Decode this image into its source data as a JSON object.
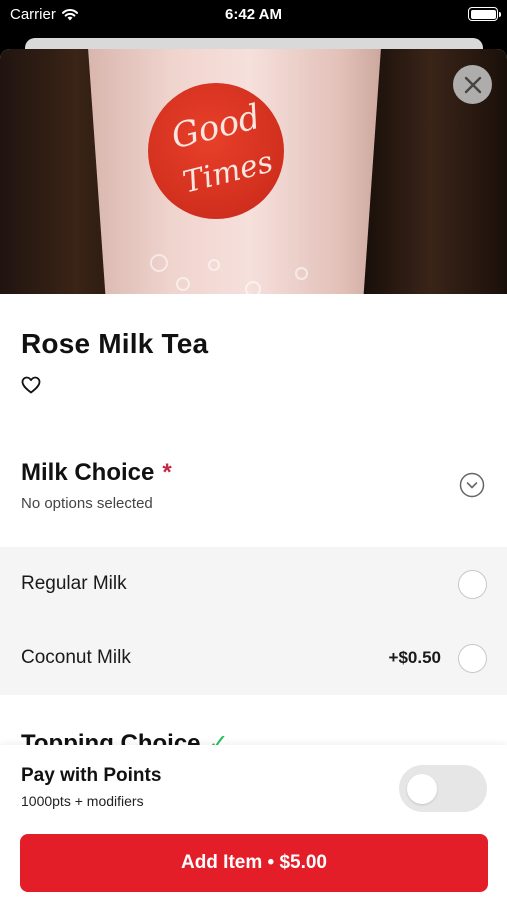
{
  "status_bar": {
    "carrier": "Carrier",
    "time": "6:42 AM"
  },
  "hero": {
    "stamp_line1": "Good",
    "stamp_line2": "Times"
  },
  "item": {
    "title": "Rose Milk Tea"
  },
  "milk_choice": {
    "title": "Milk Choice",
    "required_mark": "*",
    "subtitle": "No options selected",
    "options": [
      {
        "label": "Regular Milk",
        "price": "",
        "selected": false
      },
      {
        "label": "Coconut Milk",
        "price": "+$0.50",
        "selected": false
      }
    ]
  },
  "topping_choice": {
    "title": "Topping Choice",
    "check": "✓"
  },
  "footer": {
    "points_title": "Pay with Points",
    "points_subtitle": "1000pts + modifiers",
    "points_toggle_on": false,
    "add_button_label": "Add Item • $5.00"
  },
  "colors": {
    "accent": "#e41e28",
    "required": "#c42a44",
    "check": "#1fbf5a"
  }
}
